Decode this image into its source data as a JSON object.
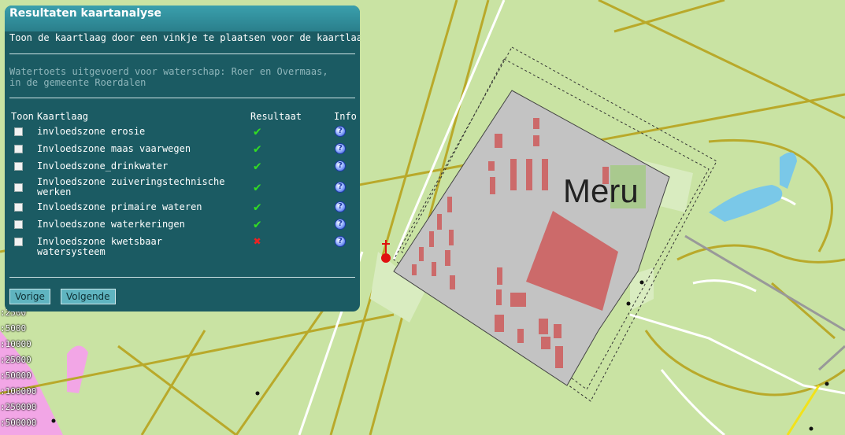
{
  "panel": {
    "title": "Resultaten kaartanalyse",
    "instruction": "Toon de kaartlaag door een vinkje te plaatsen voor de kaartlaag.",
    "info_line1": "Watertoets uitgevoerd voor waterschap: Roer en Overmaas,",
    "info_line2": "in de gemeente Roerdalen",
    "headers": {
      "toon": "Toon",
      "kaartlaag": "Kaartlaag",
      "resultaat": "Resultaat",
      "info": "Info"
    },
    "rows": [
      {
        "label": "invloedszone erosie",
        "result": "ok"
      },
      {
        "label": "Invloedszone maas vaarwegen",
        "result": "ok"
      },
      {
        "label": "Invloedszone_drinkwater",
        "result": "ok"
      },
      {
        "label": "Invloedszone zuiveringstechnische werken",
        "result": "ok"
      },
      {
        "label": "Invloedszone primaire wateren",
        "result": "ok"
      },
      {
        "label": "Invloedszone waterkeringen",
        "result": "ok"
      },
      {
        "label": "Invloedszone kwetsbaar watersysteem",
        "result": "bad"
      }
    ],
    "ok_symbol": "✔",
    "bad_symbol": "✖",
    "info_symbol": "?",
    "buttons": {
      "previous": "Vorige",
      "next": "Volgende"
    }
  },
  "map": {
    "place_label": "Meru",
    "scale_labels": [
      ":2500",
      ":5000",
      ":10000",
      ":25000",
      ":50000",
      ":100000",
      ":250000",
      ":500000"
    ]
  },
  "colors": {
    "panel_bg": "#1b5b63",
    "map_bg": "#c9e3a3",
    "road": "#b9a92a",
    "building": "#cc6a6a"
  }
}
